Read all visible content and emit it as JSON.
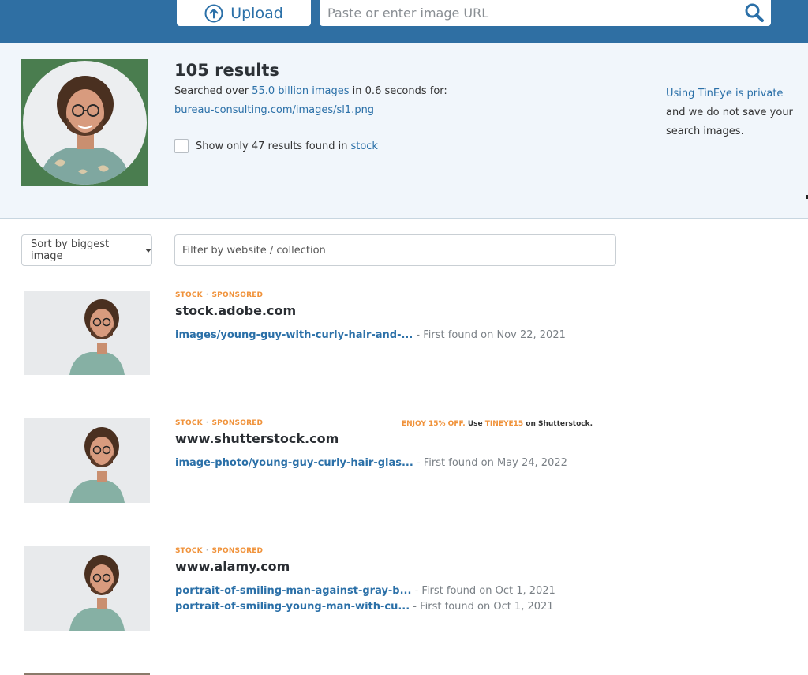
{
  "header": {
    "upload_label": "Upload",
    "upload_icon": "upload-arrow-icon",
    "url_placeholder": "Paste or enter image URL",
    "search_icon": "search-icon",
    "bar_color": "#2f6fa3"
  },
  "summary": {
    "results_count": "105 results",
    "searched_prefix": "Searched over ",
    "images_count": "55.0 billion images",
    "searched_suffix": " in 0.6 seconds for:",
    "query_url": "bureau-consulting.com/images/sl1.png",
    "stock_prefix": "Show only 47 results found in ",
    "stock_link": "stock",
    "privacy_link": "Using TinEye is private",
    "privacy_text": "and we do not save your search images."
  },
  "controls": {
    "sort_label": "Sort by biggest image",
    "filter_placeholder": "Filter by website / collection"
  },
  "results": [
    {
      "tag1": "STOCK",
      "tag2": "SPONSORED",
      "domain": "stock.adobe.com",
      "matches": [
        {
          "link": "images/young-guy-with-curly-hair-and-...",
          "date": " - First found on Nov 22, 2021"
        }
      ]
    },
    {
      "tag1": "STOCK",
      "tag2": "SPONSORED",
      "domain": "www.shutterstock.com",
      "promo": {
        "offer": "ENJOY 15% OFF.",
        "use": " Use ",
        "code": "TINEYE15",
        "suffix": " on Shutterstock."
      },
      "matches": [
        {
          "link": "image-photo/young-guy-curly-hair-glas...",
          "date": " - First found on May 24, 2022"
        }
      ]
    },
    {
      "tag1": "STOCK",
      "tag2": "SPONSORED",
      "domain": "www.alamy.com",
      "matches": [
        {
          "link": "portrait-of-smiling-man-against-gray-b...",
          "date": " - First found on Oct 1, 2021"
        },
        {
          "link": "portrait-of-smiling-young-man-with-cu...",
          "date": " - First found on Oct 1, 2021"
        }
      ]
    }
  ],
  "colors": {
    "accent": "#2b70a8",
    "tag_orange": "#f0923a",
    "summary_bg": "#f1f6fb"
  }
}
